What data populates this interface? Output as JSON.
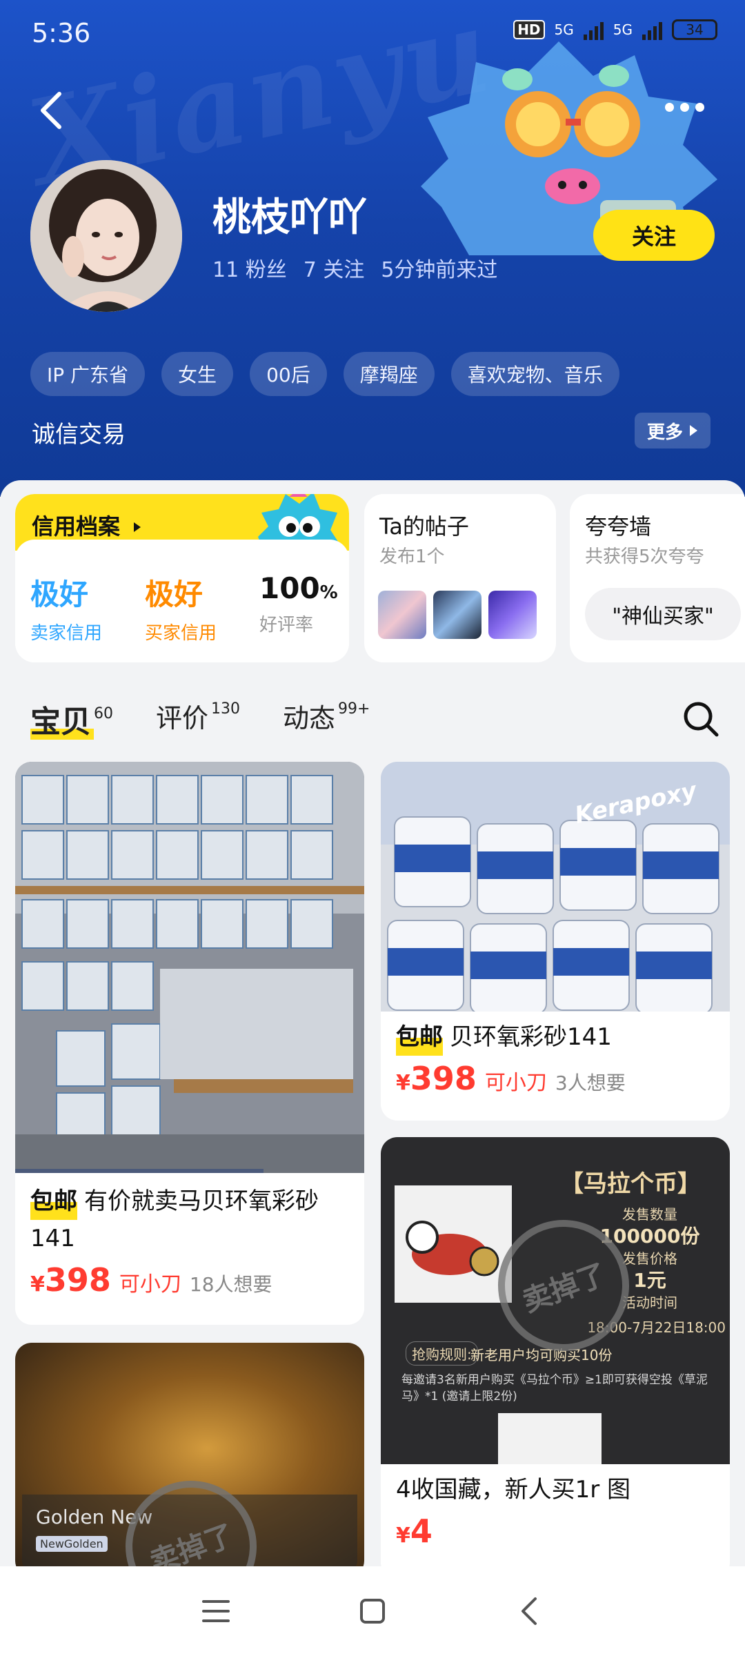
{
  "status_bar": {
    "time": "5:36",
    "hd": "HD",
    "net1": "5G",
    "net2": "5G",
    "battery": "34"
  },
  "profile": {
    "name": "桃枝吖吖",
    "fans": "11 粉丝",
    "following": "7 关注",
    "last_seen": "5分钟前来过",
    "follow_label": "关注",
    "tags": [
      "IP 广东省",
      "女生",
      "00后",
      "摩羯座",
      "喜欢宠物、音乐"
    ],
    "trust_text": "诚信交易",
    "more_label": "更多"
  },
  "credit": {
    "title": "信用档案",
    "seller_value": "极好",
    "seller_label": "卖家信用",
    "buyer_value": "极好",
    "buyer_label": "买家信用",
    "rate_value": "100",
    "rate_unit": "%",
    "rate_label": "好评率"
  },
  "posts": {
    "title": "Ta的帖子",
    "sub": "发布1个"
  },
  "praise": {
    "title": "夸夸墙",
    "sub": "共获得5次夸夸",
    "pill": "\"神仙买家\""
  },
  "tabs": [
    {
      "label": "宝贝",
      "count": "60"
    },
    {
      "label": "评价",
      "count": "130"
    },
    {
      "label": "动态",
      "count": "99+"
    }
  ],
  "products": [
    {
      "badge": "包邮",
      "title": "有价就卖马贝环氧彩砂141",
      "price_symbol": "¥",
      "price": "398",
      "bargain": "可小刀",
      "want": "18人想要"
    },
    {
      "badge": "包邮",
      "title": "贝环氧彩砂141",
      "price_symbol": "¥",
      "price": "398",
      "bargain": "可小刀",
      "want": "3人想要",
      "image_text": "Kerapoxy"
    },
    {
      "title": "4收国藏，新人买1r 图",
      "price_symbol": "¥",
      "price": "4",
      "image_title": "【马拉个币】",
      "image_lines": [
        "发售数量",
        "100000份",
        "发售价格",
        "1元",
        "活动时间",
        "18:00-7月22日18:00"
      ],
      "image_rule": "抢购规则:",
      "image_rule_text": "新老用户均可购买10份",
      "image_note": "每邀请3名新用户购买《马拉个币》≥1即可获得空投《草泥马》*1 (邀请上限2份)",
      "stamp": "卖掉了"
    },
    {
      "image_text": "Golden New",
      "image_sub": "NewGolden",
      "stamp": "卖掉了"
    }
  ],
  "colors": {
    "header_blue": "#1543aa",
    "accent_yellow": "#ffe11c",
    "price_red": "#ff3b30",
    "seller_blue": "#2ea6ff",
    "buyer_orange": "#ff8a00"
  },
  "icons": [
    "back-arrow-icon",
    "more-dots-icon",
    "search-icon",
    "menu-icon",
    "home-square-icon",
    "back-triangle-icon"
  ]
}
